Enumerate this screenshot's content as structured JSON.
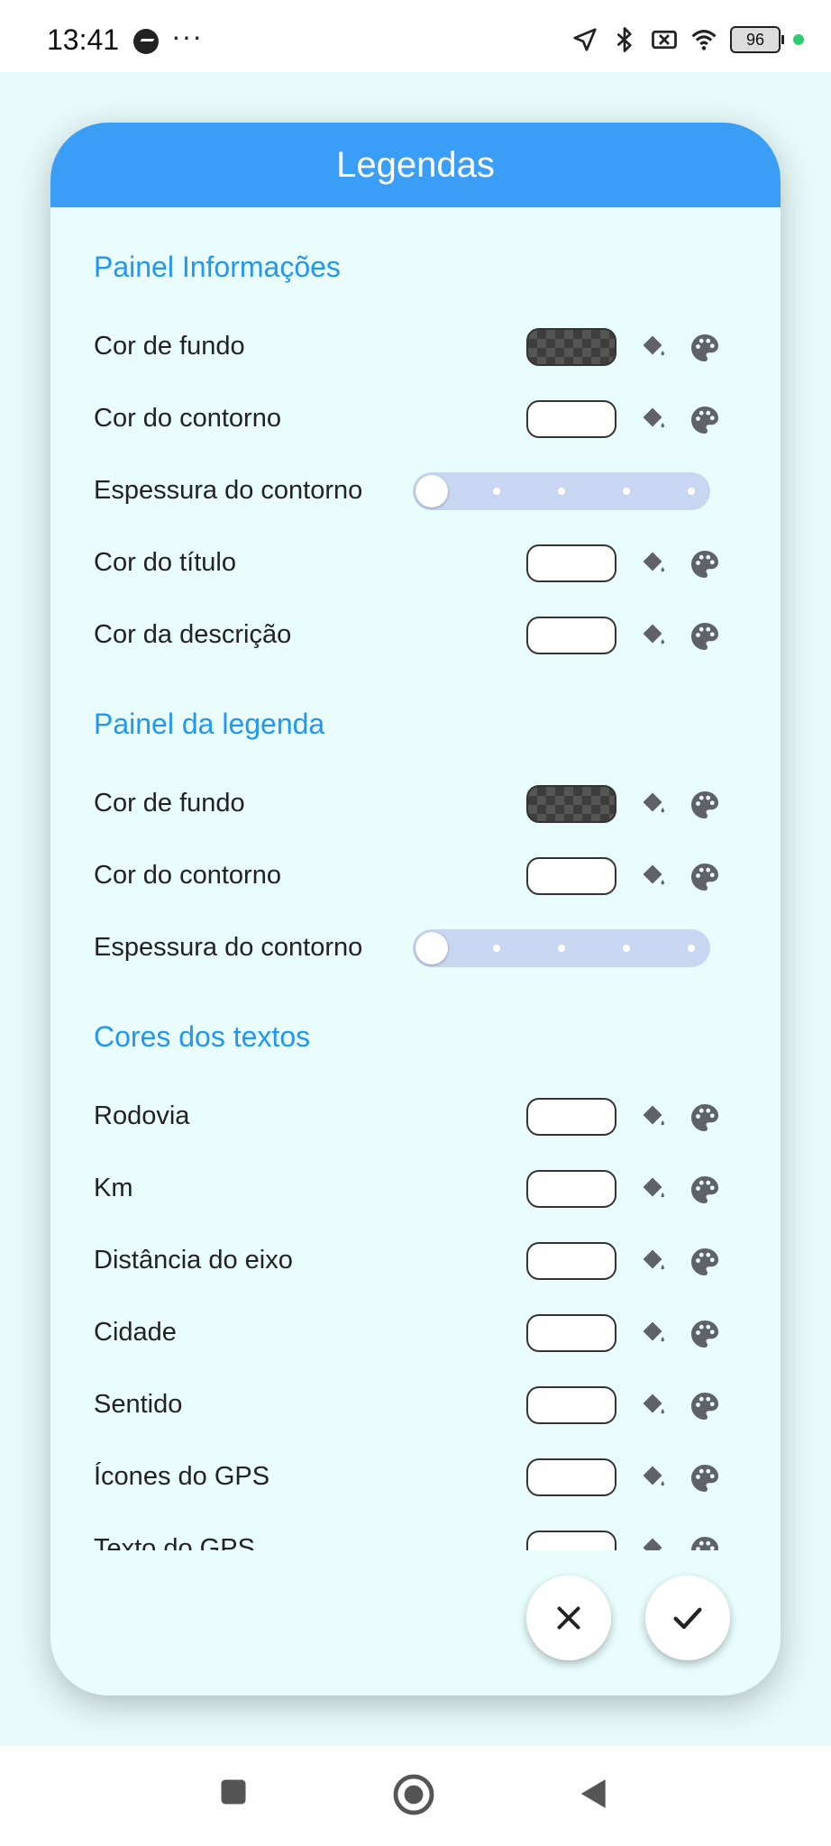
{
  "status_bar": {
    "time": "13:41",
    "more": "···",
    "battery": "96",
    "icons": [
      "messenger-icon",
      "location-icon",
      "bluetooth-icon",
      "no-sim-icon",
      "wifi-icon",
      "battery-icon",
      "privacy-dot-icon"
    ]
  },
  "dialog": {
    "title": "Legendas",
    "sections": [
      {
        "title": "Painel Informações",
        "rows": [
          {
            "label": "Cor de fundo",
            "type": "color",
            "swatch": "transparent-dark"
          },
          {
            "label": "Cor do contorno",
            "type": "color",
            "swatch": "#ffffff"
          },
          {
            "label": "Espessura do contorno",
            "type": "slider",
            "value": 0,
            "steps": 5
          },
          {
            "label": "Cor do título",
            "type": "color",
            "swatch": "#ffffff"
          },
          {
            "label": "Cor da descrição",
            "type": "color",
            "swatch": "#ffffff"
          }
        ]
      },
      {
        "title": "Painel da legenda",
        "rows": [
          {
            "label": "Cor de fundo",
            "type": "color",
            "swatch": "transparent-dark"
          },
          {
            "label": "Cor do contorno",
            "type": "color",
            "swatch": "#ffffff"
          },
          {
            "label": "Espessura do contorno",
            "type": "slider",
            "value": 0,
            "steps": 5
          }
        ]
      },
      {
        "title": "Cores dos textos",
        "rows": [
          {
            "label": "Rodovia",
            "type": "color",
            "swatch": "#ffffff"
          },
          {
            "label": "Km",
            "type": "color",
            "swatch": "#ffffff"
          },
          {
            "label": "Distância do eixo",
            "type": "color",
            "swatch": "#ffffff"
          },
          {
            "label": "Cidade",
            "type": "color",
            "swatch": "#ffffff"
          },
          {
            "label": "Sentido",
            "type": "color",
            "swatch": "#ffffff"
          },
          {
            "label": "Ícones do GPS",
            "type": "color",
            "swatch": "#ffffff"
          },
          {
            "label": "Texto do GPS",
            "type": "color",
            "swatch": "#ffffff"
          }
        ]
      }
    ],
    "icons": {
      "fill": "format-color-fill-icon",
      "palette": "palette-icon"
    },
    "actions": {
      "cancel": "close-icon",
      "confirm": "check-icon"
    }
  },
  "colors": {
    "header": "#3a9df6",
    "section_title": "#2196f3",
    "dialog_bg": "#e9fdfd",
    "slider_track": "#c9d6f1"
  },
  "nav_bar": {
    "icons": [
      "recents-square-icon",
      "home-circle-icon",
      "back-triangle-icon"
    ]
  }
}
